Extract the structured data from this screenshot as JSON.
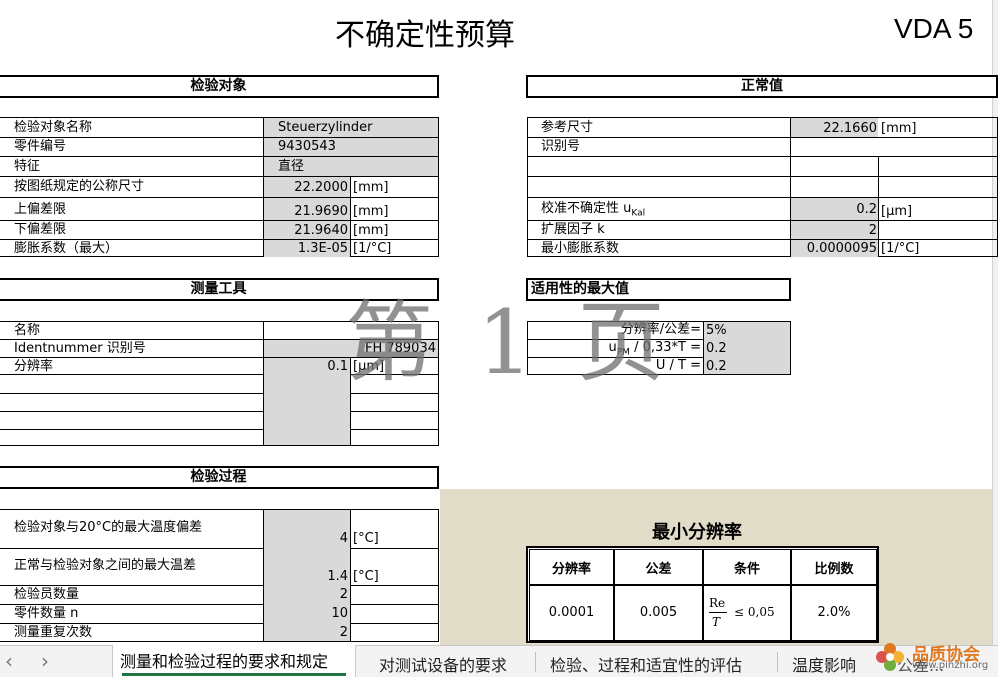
{
  "title": "不确定性预算",
  "badge": "VDA 5",
  "watermark": "第 1 页",
  "sections": {
    "test_object": "检验对象",
    "normal": "正常值",
    "tool": "测量工具",
    "suitability": "适用性的最大值",
    "process": "检验过程",
    "min_resolution": "最小分辨率"
  },
  "test_object": {
    "name_label": "检验对象名称",
    "name_value": "Steuerzylinder",
    "part_label": "零件编号",
    "part_value": "9430543",
    "feature_label": "特征",
    "feature_value": "直径",
    "nominal_label": "按图纸规定的公称尺寸",
    "nominal_value": "22.2000",
    "nominal_unit": "[mm]",
    "upper_label": "上偏差限",
    "upper_value": "21.9690",
    "upper_unit": "[mm]",
    "lower_label": "下偏差限",
    "lower_value": "21.9640",
    "lower_unit": "[mm]",
    "expansion_label": "膨胀系数（最大）",
    "expansion_value": "1.3E-05",
    "expansion_unit": "[1/°C]"
  },
  "normal": {
    "ref_label": "参考尺寸",
    "ref_value": "22.1660",
    "ref_unit": "[mm]",
    "id_label": "识别号",
    "ukal_label": "校准不确定性 u",
    "ukal_sub": "Kal",
    "ukal_value": "0.2",
    "ukal_unit": "[µm]",
    "k_label": "扩展因子 k",
    "k_value": "2",
    "minexp_label": "最小膨胀系数",
    "minexp_value": "0.0000095",
    "minexp_unit": "[1/°C]"
  },
  "tool": {
    "name_label": "名称",
    "ident_label": "Identnummer 识别号",
    "ident_value": "FH 789034",
    "res_label": "分辨率",
    "res_value": "0.1",
    "res_unit": "[µm]"
  },
  "suitability": {
    "r1_label": "分辨率/公差=",
    "r1_value": "5%",
    "r2_label_pre": "u",
    "r2_label_sub": "PM",
    "r2_label_post": " / 0,33*T =",
    "r2_value": "0.2",
    "r3_label": "U / T =",
    "r3_value": "0.2"
  },
  "process": {
    "temp_obj_label": "检验对象与20°C的最大温度偏差",
    "temp_obj_value": "4",
    "temp_obj_unit": "[°C]",
    "temp_diff_label": "正常与检验对象之间的最大温差",
    "temp_diff_value": "1.4",
    "temp_diff_unit": "[°C]",
    "inspectors_label": "检验员数量",
    "inspectors_value": "2",
    "parts_label": "零件数量 n",
    "parts_value": "10",
    "repeats_label": "测量重复次数",
    "repeats_value": "2"
  },
  "min_res_table": {
    "headers": [
      "分辨率",
      "公差",
      "条件",
      "比例数"
    ],
    "row": [
      "0.0001",
      "0.005",
      "",
      "2.0%"
    ],
    "cond_num": "Re",
    "cond_den": "T",
    "cond_rel": "≤  0,05"
  },
  "tabs": {
    "prev": "‹",
    "next": "›",
    "items": [
      "测量和检验过程的要求和规定",
      "对测试设备的要求",
      "检验、过程和适宜性的评估",
      "温度影响",
      "公差..."
    ]
  },
  "logo": {
    "text": "品质协会",
    "url": "www.pinzhi.org"
  },
  "colors": {
    "gray_cell": "#d9d9d9",
    "tan_area": "#e1dcc8",
    "logo_orange": "#e07820"
  }
}
